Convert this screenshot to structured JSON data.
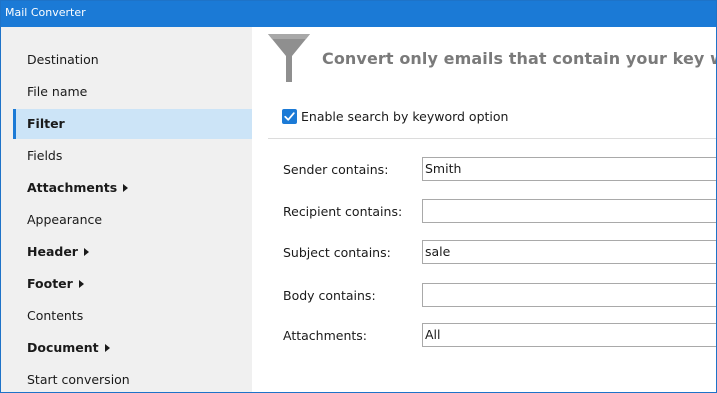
{
  "window": {
    "title": "Mail Converter"
  },
  "sidebar": {
    "items": [
      {
        "label": "Destination",
        "bold": false,
        "submenu": false,
        "selected": false
      },
      {
        "label": "File name",
        "bold": false,
        "submenu": false,
        "selected": false
      },
      {
        "label": "Filter",
        "bold": true,
        "submenu": false,
        "selected": true
      },
      {
        "label": "Fields",
        "bold": false,
        "submenu": false,
        "selected": false
      },
      {
        "label": "Attachments",
        "bold": true,
        "submenu": true,
        "selected": false
      },
      {
        "label": "Appearance",
        "bold": false,
        "submenu": false,
        "selected": false
      },
      {
        "label": "Header",
        "bold": true,
        "submenu": true,
        "selected": false
      },
      {
        "label": "Footer",
        "bold": true,
        "submenu": true,
        "selected": false
      },
      {
        "label": "Contents",
        "bold": false,
        "submenu": false,
        "selected": false
      },
      {
        "label": "Document",
        "bold": true,
        "submenu": true,
        "selected": false
      },
      {
        "label": "Start conversion",
        "bold": false,
        "submenu": false,
        "selected": false
      }
    ]
  },
  "main": {
    "heading": "Convert only emails that contain your key words",
    "heading_icon": "funnel-icon",
    "enable_search": {
      "label": "Enable search by keyword option",
      "checked": true
    },
    "fields": {
      "sender": {
        "label": "Sender contains:",
        "value": "Smith"
      },
      "recipient": {
        "label": "Recipient contains:",
        "value": ""
      },
      "subject": {
        "label": "Subject contains:",
        "value": "sale"
      },
      "body": {
        "label": "Body contains:",
        "value": ""
      },
      "attachments": {
        "label": "Attachments:",
        "value": "All"
      }
    }
  },
  "colors": {
    "accent": "#1b7ad6",
    "sidebar_bg": "#f0f0f0",
    "selected_bg": "#cce4f7",
    "heading": "#7a7a7a"
  }
}
